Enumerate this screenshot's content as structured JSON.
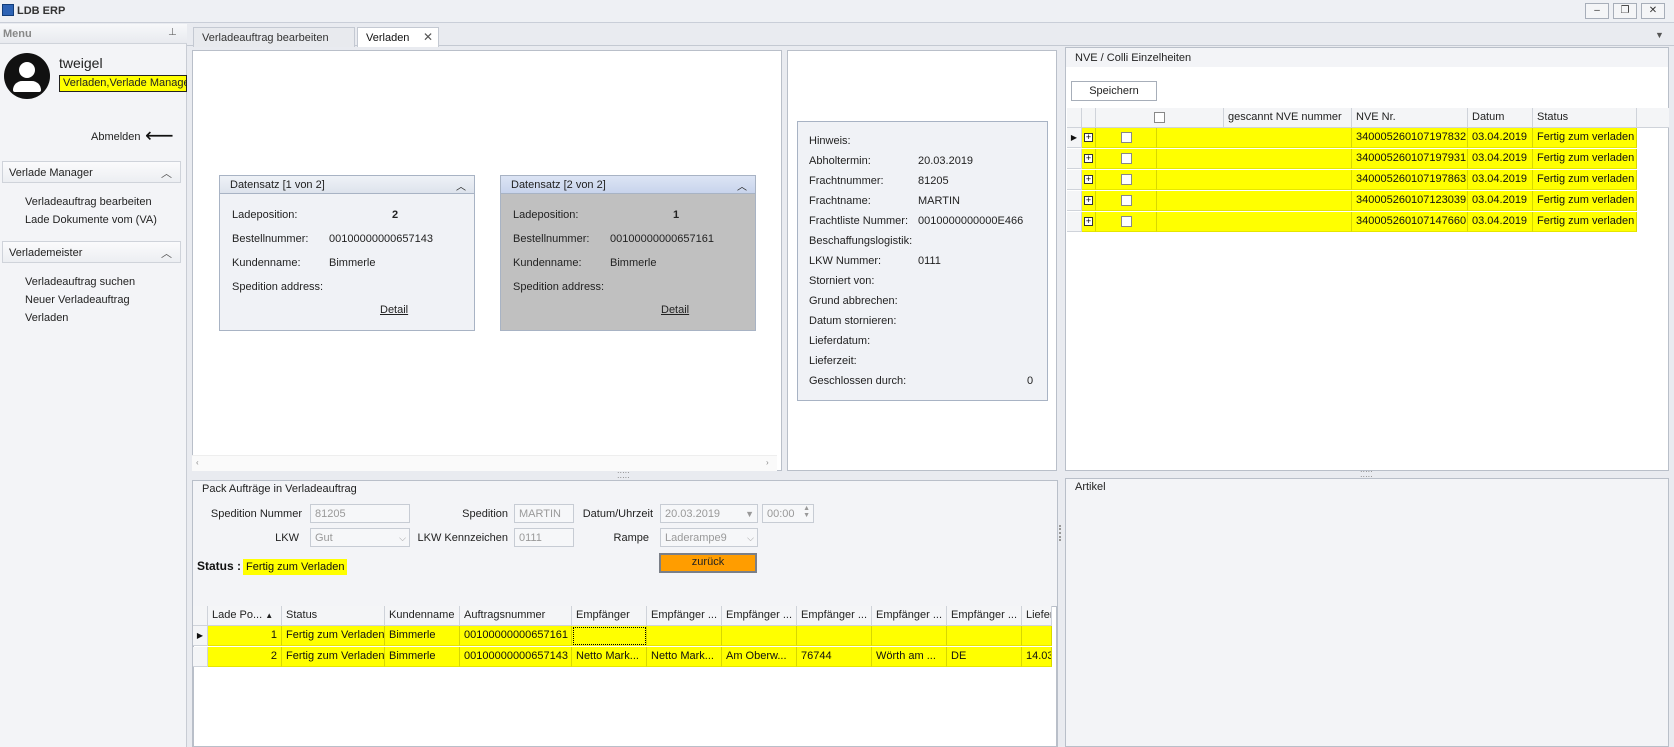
{
  "window": {
    "title": "LDB ERP",
    "controls": {
      "minimize": "–",
      "restore": "❐",
      "close": "✕"
    }
  },
  "sidebar": {
    "menu_label": "Menu",
    "username": "tweigel",
    "roles": "Verladen,Verlade Manager",
    "logout": "Abmelden",
    "groups": [
      {
        "title": "Verlade Manager",
        "items": [
          "Verladeauftrag bearbeiten",
          "Lade Dokumente vom (VA)"
        ]
      },
      {
        "title": "Verlademeister",
        "items": [
          "Verladeauftrag suchen",
          "Neuer Verladeauftrag",
          "Verladen"
        ]
      }
    ]
  },
  "tabs": [
    {
      "label": "Verladeauftrag bearbeiten"
    },
    {
      "label": "Verladen",
      "close": "✕"
    }
  ],
  "records": [
    {
      "title": "Datensatz [1 von 2]",
      "ladeposition_label": "Ladeposition:",
      "ladeposition": "2",
      "bestellnummer_label": "Bestellnummer:",
      "bestellnummer": "00100000000657143",
      "kundenname_label": "Kundenname:",
      "kundenname": "Bimmerle",
      "spedition_label": "Spedition address:",
      "detail": "Detail"
    },
    {
      "title": "Datensatz [2 von 2]",
      "ladeposition_label": "Ladeposition:",
      "ladeposition": "1",
      "bestellnummer_label": "Bestellnummer:",
      "bestellnummer": "00100000000657161",
      "kundenname_label": "Kundenname:",
      "kundenname": "Bimmerle",
      "spedition_label": "Spedition address:",
      "detail": "Detail"
    }
  ],
  "info": {
    "hinweis_label": "Hinweis:",
    "abholtermin_label": "Abholtermin:",
    "abholtermin": "20.03.2019",
    "frachtnummer_label": "Frachtnummer:",
    "frachtnummer": "81205",
    "frachtname_label": "Frachtname:",
    "frachtname": "MARTIN",
    "frachtliste_label": "Frachtliste Nummer:",
    "frachtliste": "0010000000000E466",
    "beschaffung_label": "Beschaffungslogistik:",
    "lkw_label": "LKW Nummer:",
    "lkw": "0111",
    "storniert_label": "Storniert von:",
    "grund_label": "Grund abbrechen:",
    "datum_storn_label": "Datum stornieren:",
    "lieferdatum_label": "Lieferdatum:",
    "lieferzeit_label": "Lieferzeit:",
    "geschlossen_label": "Geschlossen durch:",
    "geschlossen": "0"
  },
  "nve": {
    "title": "NVE / Colli Einzelheiten",
    "save_button": "Speichern",
    "columns": [
      "gescannt NVE nummer",
      "NVE Nr.",
      "Datum",
      "Status"
    ],
    "rows": [
      {
        "nve": "340005260107197832",
        "datum": "03.04.2019",
        "status": "Fertig zum verladen"
      },
      {
        "nve": "340005260107197931",
        "datum": "03.04.2019",
        "status": "Fertig zum verladen"
      },
      {
        "nve": "340005260107197863",
        "datum": "03.04.2019",
        "status": "Fertig zum verladen"
      },
      {
        "nve": "340005260107123039",
        "datum": "03.04.2019",
        "status": "Fertig zum verladen"
      },
      {
        "nve": "340005260107147660",
        "datum": "03.04.2019",
        "status": "Fertig zum verladen"
      }
    ]
  },
  "pack": {
    "title": "Pack Aufträge in Verladeauftrag",
    "spedition_nummer_label": "Spedition Nummer",
    "spedition_nummer": "81205",
    "spedition_label": "Spedition",
    "spedition": "MARTIN",
    "datum_label": "Datum/Uhrzeit",
    "datum": "20.03.2019",
    "uhrzeit": "00:00",
    "lkw_label": "LKW",
    "lkw": "Gut",
    "kennzeichen_label": "LKW Kennzeichen",
    "kennzeichen": "0111",
    "rampe_label": "Rampe",
    "rampe": "Laderampe9",
    "status_label": "Status :",
    "status": "Fertig zum Verladen",
    "back_button": "zurück",
    "columns": [
      "Lade Po...",
      "Status",
      "Kundenname",
      "Auftragsnummer",
      "Empfänger",
      "Empfänger ...",
      "Empfänger ...",
      "Empfänger ...",
      "Empfänger ...",
      "Empfänger ...",
      "Liefer"
    ],
    "rows": [
      [
        "1",
        "Fertig zum Verladen",
        "Bimmerle",
        "00100000000657161",
        "",
        "",
        "",
        "",
        "",
        "",
        ""
      ],
      [
        "2",
        "Fertig zum Verladen",
        "Bimmerle",
        "00100000000657143",
        "Netto Mark...",
        "Netto Mark...",
        "Am Oberw...",
        "76744",
        "Wörth am ...",
        "DE",
        "14.03"
      ]
    ]
  },
  "artikel": {
    "title": "Artikel"
  },
  "colors": {
    "highlight": "#ffff00",
    "back_button": "#ff9d00",
    "sidebar_bg": "#f3f4f7"
  }
}
